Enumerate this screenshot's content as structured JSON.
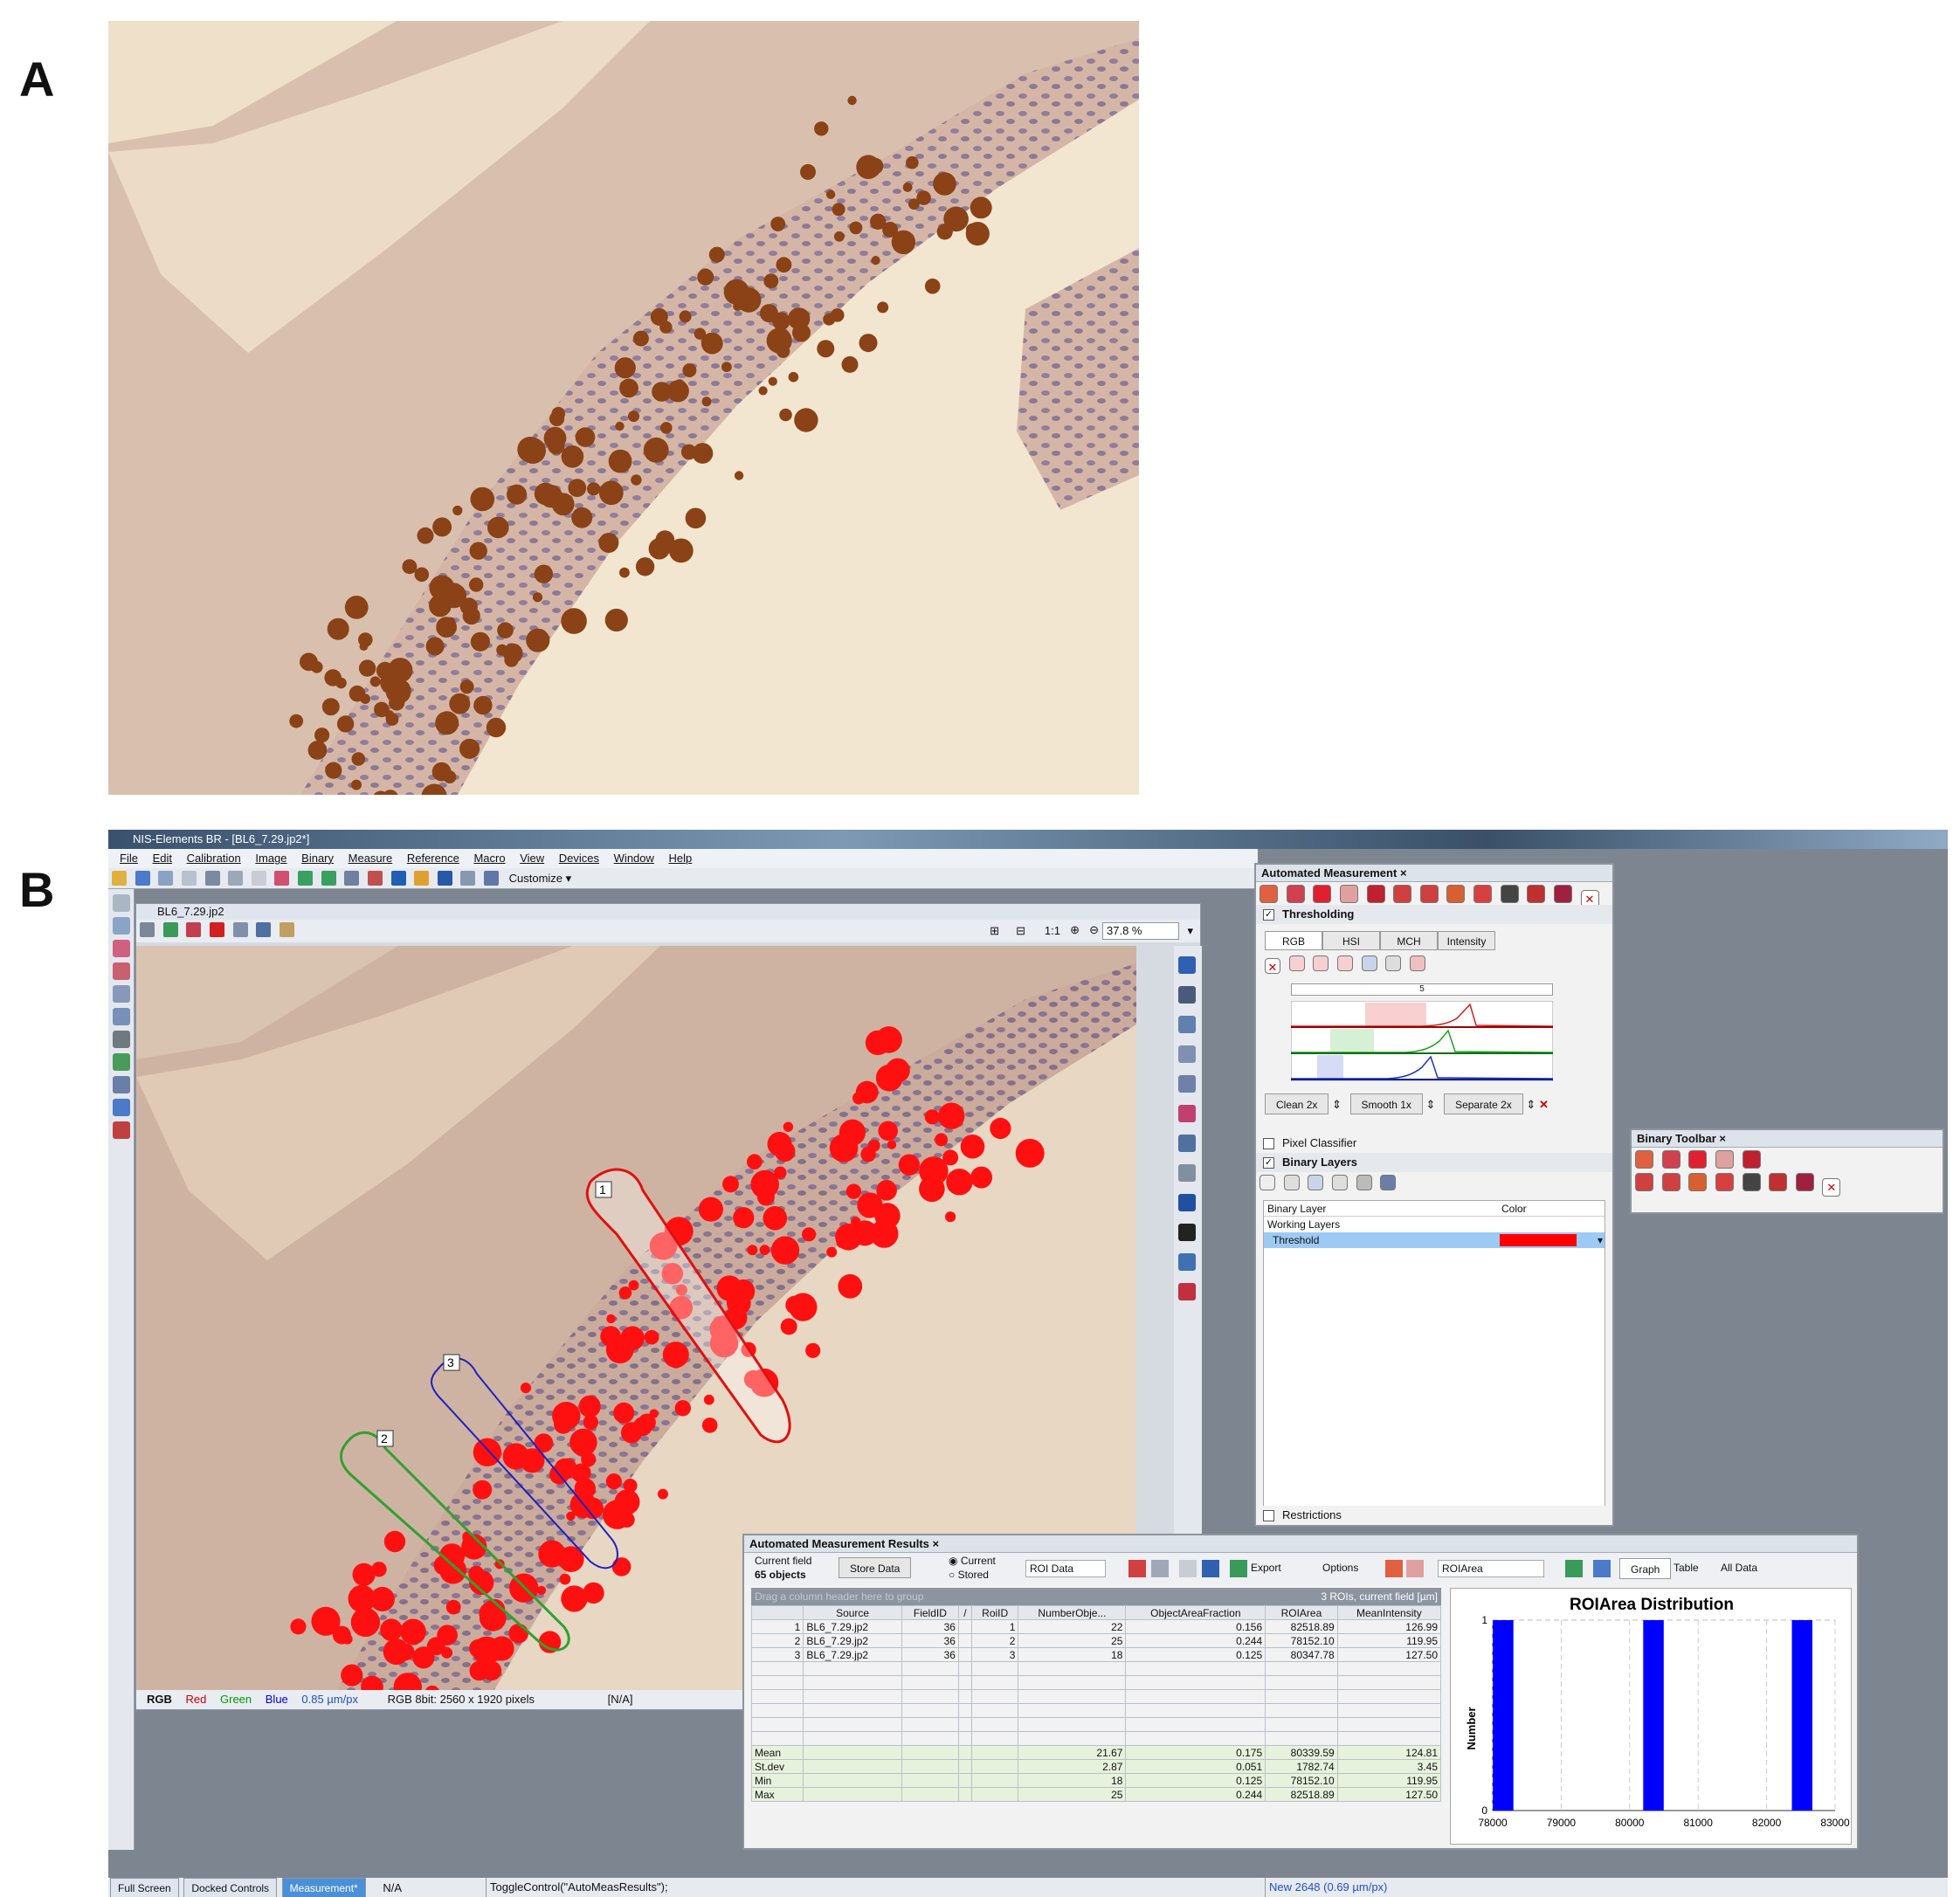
{
  "labels": {
    "panel_a": "A",
    "panel_b": "B"
  },
  "app": {
    "title": "NIS-Elements BR  - [BL6_7.29.jp2*]",
    "menu": [
      "File",
      "Edit",
      "Calibration",
      "Image",
      "Binary",
      "Measure",
      "Reference",
      "Macro",
      "View",
      "Devices",
      "Window",
      "Help"
    ],
    "customize_label": "Customize"
  },
  "image_window": {
    "title": "BL6_7.29.jp2",
    "zoom_ratio_label": "1:1",
    "zoom": "37.8 %",
    "channel_tabs": [
      "RGB",
      "Red",
      "Green",
      "Blue"
    ],
    "calibration": "0.85 µm/px",
    "image_info": "RGB 8bit: 2560 x 1920 pixels",
    "na": "[N/A]",
    "roi_labels": [
      "1",
      "2",
      "3"
    ]
  },
  "automated_measurement": {
    "title": "Automated Measurement",
    "thresholding_label": "Thresholding",
    "thresholding_checked": true,
    "color_tabs": [
      "RGB",
      "HSI",
      "MCH",
      "Intensity"
    ],
    "slider_value": "5",
    "clean_label": "Clean 2x",
    "smooth_label": "Smooth 1x",
    "separate_label": "Separate 2x",
    "pixel_classifier_label": "Pixel Classifier",
    "binary_layers_label": "Binary Layers",
    "binary_layers_checked": true,
    "layer_table": {
      "headers": [
        "Binary Layer",
        "Color"
      ],
      "group": "Working Layers",
      "row_name": "Threshold",
      "row_color": "#ff0000"
    },
    "restrictions_label": "Restrictions"
  },
  "binary_toolbar": {
    "title": "Binary Toolbar"
  },
  "results": {
    "title": "Automated Measurement Results",
    "current_field_label": "Current field",
    "object_count": "65 objects",
    "store_button": "Store Data",
    "radio_current": "Current",
    "radio_stored": "Stored",
    "data_select": "ROI Data",
    "export_label": "Export",
    "options_label": "Options",
    "feature_select": "ROIArea",
    "graph_tab": "Graph",
    "table_tab": "Table",
    "alldata_select": "All Data",
    "group_hint": "Drag a column header here to group",
    "roi_info": "3 ROIs, current field [µm]",
    "columns": [
      "",
      "Source",
      "FieldID",
      "/",
      "RoiID",
      "NumberObje...",
      "ObjectAreaFraction",
      "ROIArea",
      "MeanIntensity"
    ],
    "rows": [
      [
        "1",
        "BL6_7.29.jp2",
        "36",
        "",
        "1",
        "22",
        "0.156",
        "82518.89",
        "126.99"
      ],
      [
        "2",
        "BL6_7.29.jp2",
        "36",
        "",
        "2",
        "25",
        "0.244",
        "78152.10",
        "119.95"
      ],
      [
        "3",
        "BL6_7.29.jp2",
        "36",
        "",
        "3",
        "18",
        "0.125",
        "80347.78",
        "127.50"
      ]
    ],
    "stats": [
      [
        "Mean",
        "",
        "",
        "",
        "",
        "21.67",
        "0.175",
        "80339.59",
        "124.81"
      ],
      [
        "St.dev",
        "",
        "",
        "",
        "",
        "2.87",
        "0.051",
        "1782.74",
        "3.45"
      ],
      [
        "Min",
        "",
        "",
        "",
        "",
        "18",
        "0.125",
        "78152.10",
        "119.95"
      ],
      [
        "Max",
        "",
        "",
        "",
        "",
        "25",
        "0.244",
        "82518.89",
        "127.50"
      ]
    ]
  },
  "chart_data": {
    "type": "bar",
    "title": "ROIArea Distribution",
    "ylabel": "Number",
    "xlabel": "",
    "xlim": [
      78000,
      83000
    ],
    "ylim": [
      0,
      1
    ],
    "x_ticks": [
      "78000",
      "79000",
      "80000",
      "81000",
      "82000",
      "83000"
    ],
    "y_ticks": [
      "0",
      "1"
    ],
    "bins": [
      {
        "x": 78152.1,
        "value": 1
      },
      {
        "x": 80347.78,
        "value": 1
      },
      {
        "x": 82518.89,
        "value": 1
      }
    ],
    "bar_color": "#0000ff"
  },
  "statusbar": {
    "tabs": [
      "Full Screen",
      "Docked Controls",
      "Measurement*"
    ],
    "na": "N/A",
    "command": "ToggleControl(\"AutoMeasResults\");",
    "info": "New 2648 (0.69 µm/px)"
  }
}
